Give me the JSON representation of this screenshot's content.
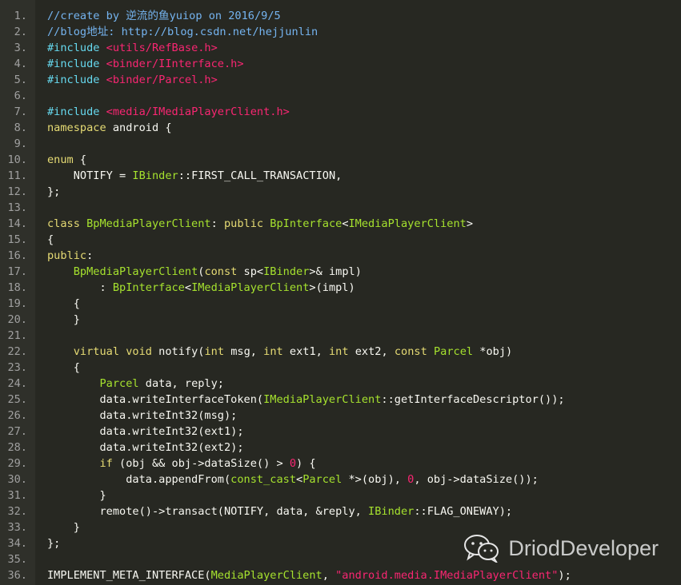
{
  "colors": {
    "background": "#272822",
    "gutter": "#2f302a",
    "line_number": "#a0a0a0",
    "comment": "#75b4f0",
    "preprocessor": "#66d9ef",
    "string": "#f92672",
    "keyword": "#e6db74",
    "type": "#a6e22e",
    "plain": "#f8f8f2"
  },
  "watermark": {
    "text": "DriodDeveloper",
    "icon": "wechat-icon"
  },
  "lines": [
    {
      "n": "1.",
      "tokens": [
        [
          "comment",
          "//create by 逆流的鱼yuiop on 2016/9/5"
        ]
      ]
    },
    {
      "n": "2.",
      "tokens": [
        [
          "comment",
          "//blog地址: http://blog.csdn.net/hejjunlin"
        ]
      ]
    },
    {
      "n": "3.",
      "tokens": [
        [
          "preproc",
          "#include "
        ],
        [
          "string",
          "<utils/RefBase.h>"
        ]
      ]
    },
    {
      "n": "4.",
      "tokens": [
        [
          "preproc",
          "#include "
        ],
        [
          "string",
          "<binder/IInterface.h>"
        ]
      ]
    },
    {
      "n": "5.",
      "tokens": [
        [
          "preproc",
          "#include "
        ],
        [
          "string",
          "<binder/Parcel.h>"
        ]
      ]
    },
    {
      "n": "6.",
      "tokens": []
    },
    {
      "n": "7.",
      "tokens": [
        [
          "preproc",
          "#include "
        ],
        [
          "string",
          "<media/IMediaPlayerClient.h>"
        ]
      ]
    },
    {
      "n": "8.",
      "tokens": [
        [
          "keyword",
          "namespace"
        ],
        [
          "plain",
          " android {"
        ]
      ]
    },
    {
      "n": "9.",
      "tokens": []
    },
    {
      "n": "10.",
      "tokens": [
        [
          "keyword",
          "enum"
        ],
        [
          "plain",
          " {"
        ]
      ]
    },
    {
      "n": "11.",
      "tokens": [
        [
          "plain",
          "    NOTIFY = "
        ],
        [
          "type",
          "IBinder"
        ],
        [
          "plain",
          "::FIRST_CALL_TRANSACTION,"
        ]
      ]
    },
    {
      "n": "12.",
      "tokens": [
        [
          "plain",
          "};"
        ]
      ]
    },
    {
      "n": "13.",
      "tokens": []
    },
    {
      "n": "14.",
      "tokens": [
        [
          "keyword",
          "class"
        ],
        [
          "plain",
          " "
        ],
        [
          "type",
          "BpMediaPlayerClient"
        ],
        [
          "plain",
          ": "
        ],
        [
          "keyword",
          "public"
        ],
        [
          "plain",
          " "
        ],
        [
          "type",
          "BpInterface"
        ],
        [
          "plain",
          "<"
        ],
        [
          "type",
          "IMediaPlayerClient"
        ],
        [
          "plain",
          ">"
        ]
      ]
    },
    {
      "n": "15.",
      "tokens": [
        [
          "plain",
          "{"
        ]
      ]
    },
    {
      "n": "16.",
      "tokens": [
        [
          "keyword",
          "public"
        ],
        [
          "plain",
          ":"
        ]
      ]
    },
    {
      "n": "17.",
      "tokens": [
        [
          "plain",
          "    "
        ],
        [
          "type",
          "BpMediaPlayerClient"
        ],
        [
          "plain",
          "("
        ],
        [
          "keyword",
          "const"
        ],
        [
          "plain",
          " sp<"
        ],
        [
          "type",
          "IBinder"
        ],
        [
          "plain",
          ">& impl)"
        ]
      ]
    },
    {
      "n": "18.",
      "tokens": [
        [
          "plain",
          "        : "
        ],
        [
          "type",
          "BpInterface"
        ],
        [
          "plain",
          "<"
        ],
        [
          "type",
          "IMediaPlayerClient"
        ],
        [
          "plain",
          ">(impl)"
        ]
      ]
    },
    {
      "n": "19.",
      "tokens": [
        [
          "plain",
          "    {"
        ]
      ]
    },
    {
      "n": "20.",
      "tokens": [
        [
          "plain",
          "    }"
        ]
      ]
    },
    {
      "n": "21.",
      "tokens": []
    },
    {
      "n": "22.",
      "tokens": [
        [
          "plain",
          "    "
        ],
        [
          "keyword",
          "virtual"
        ],
        [
          "plain",
          " "
        ],
        [
          "keyword",
          "void"
        ],
        [
          "plain",
          " notify("
        ],
        [
          "keyword",
          "int"
        ],
        [
          "plain",
          " msg, "
        ],
        [
          "keyword",
          "int"
        ],
        [
          "plain",
          " ext1, "
        ],
        [
          "keyword",
          "int"
        ],
        [
          "plain",
          " ext2, "
        ],
        [
          "keyword",
          "const"
        ],
        [
          "plain",
          " "
        ],
        [
          "type",
          "Parcel"
        ],
        [
          "plain",
          " *obj)"
        ]
      ]
    },
    {
      "n": "23.",
      "tokens": [
        [
          "plain",
          "    {"
        ]
      ]
    },
    {
      "n": "24.",
      "tokens": [
        [
          "plain",
          "        "
        ],
        [
          "type",
          "Parcel"
        ],
        [
          "plain",
          " data, reply;"
        ]
      ]
    },
    {
      "n": "25.",
      "tokens": [
        [
          "plain",
          "        data.writeInterfaceToken("
        ],
        [
          "type",
          "IMediaPlayerClient"
        ],
        [
          "plain",
          "::getInterfaceDescriptor());"
        ]
      ]
    },
    {
      "n": "26.",
      "tokens": [
        [
          "plain",
          "        data.writeInt32(msg);"
        ]
      ]
    },
    {
      "n": "27.",
      "tokens": [
        [
          "plain",
          "        data.writeInt32(ext1);"
        ]
      ]
    },
    {
      "n": "28.",
      "tokens": [
        [
          "plain",
          "        data.writeInt32(ext2);"
        ]
      ]
    },
    {
      "n": "29.",
      "tokens": [
        [
          "plain",
          "        "
        ],
        [
          "keyword",
          "if"
        ],
        [
          "plain",
          " (obj && obj->dataSize() > "
        ],
        [
          "number",
          "0"
        ],
        [
          "plain",
          ") {"
        ]
      ]
    },
    {
      "n": "30.",
      "tokens": [
        [
          "plain",
          "            data.appendFrom("
        ],
        [
          "type",
          "const_cast"
        ],
        [
          "plain",
          "<"
        ],
        [
          "type",
          "Parcel"
        ],
        [
          "plain",
          " *>(obj), "
        ],
        [
          "number",
          "0"
        ],
        [
          "plain",
          ", obj->dataSize());"
        ]
      ]
    },
    {
      "n": "31.",
      "tokens": [
        [
          "plain",
          "        }"
        ]
      ]
    },
    {
      "n": "32.",
      "tokens": [
        [
          "plain",
          "        remote()->transact(NOTIFY, data, &reply, "
        ],
        [
          "type",
          "IBinder"
        ],
        [
          "plain",
          "::FLAG_ONEWAY);"
        ]
      ]
    },
    {
      "n": "33.",
      "tokens": [
        [
          "plain",
          "    }"
        ]
      ]
    },
    {
      "n": "34.",
      "tokens": [
        [
          "plain",
          "};"
        ]
      ]
    },
    {
      "n": "35.",
      "tokens": []
    },
    {
      "n": "36.",
      "tokens": [
        [
          "plain",
          "IMPLEMENT_META_INTERFACE("
        ],
        [
          "type",
          "MediaPlayerClient"
        ],
        [
          "plain",
          ", "
        ],
        [
          "string",
          "\"android.media.IMediaPlayerClient\""
        ],
        [
          "plain",
          ");"
        ]
      ]
    }
  ]
}
